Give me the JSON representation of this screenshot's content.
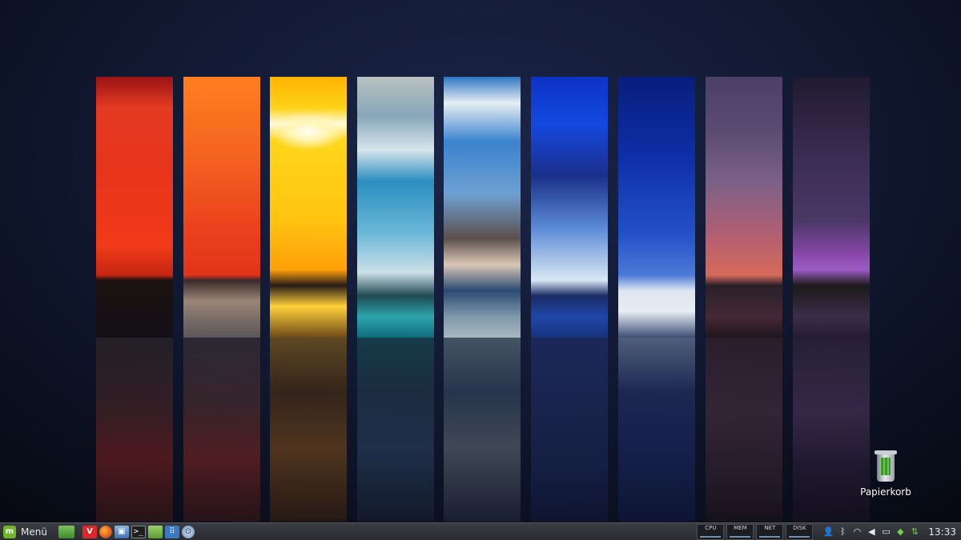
{
  "desktop": {
    "icons": [
      {
        "name": "trash",
        "label": "Papierkorb",
        "icon": "trash-icon"
      }
    ]
  },
  "taskbar": {
    "menu_label": "Menü",
    "menu_icon": "linux-mint-logo-icon",
    "launchers": [
      {
        "name": "show-desktop",
        "icon": "show-desktop-icon",
        "glyph": ""
      },
      {
        "name": "vivaldi",
        "icon": "vivaldi-browser-icon",
        "glyph": "V"
      },
      {
        "name": "firefox",
        "icon": "firefox-icon",
        "glyph": ""
      },
      {
        "name": "image-viewer",
        "icon": "image-viewer-icon",
        "glyph": "▣"
      },
      {
        "name": "terminal",
        "icon": "terminal-icon",
        "glyph": ">_"
      },
      {
        "name": "files",
        "icon": "folder-icon",
        "glyph": ""
      },
      {
        "name": "app-grid",
        "icon": "app-grid-icon",
        "glyph": "⠿"
      },
      {
        "name": "lock",
        "icon": "lock-screen-icon",
        "glyph": "⊙"
      }
    ],
    "monitors": [
      {
        "name": "cpu",
        "label": "CPU"
      },
      {
        "name": "mem",
        "label": "MEM"
      },
      {
        "name": "net",
        "label": "NET"
      },
      {
        "name": "disk",
        "label": "DISK"
      }
    ],
    "tray_icons": [
      "user-icon",
      "bluetooth-icon",
      "wifi-icon",
      "volume-icon",
      "keyboard-icon",
      "shield-icon",
      "update-icon"
    ],
    "clock": "13:33",
    "colors": {
      "accent": "#6fb52c",
      "panel": "#2a2c30"
    }
  }
}
